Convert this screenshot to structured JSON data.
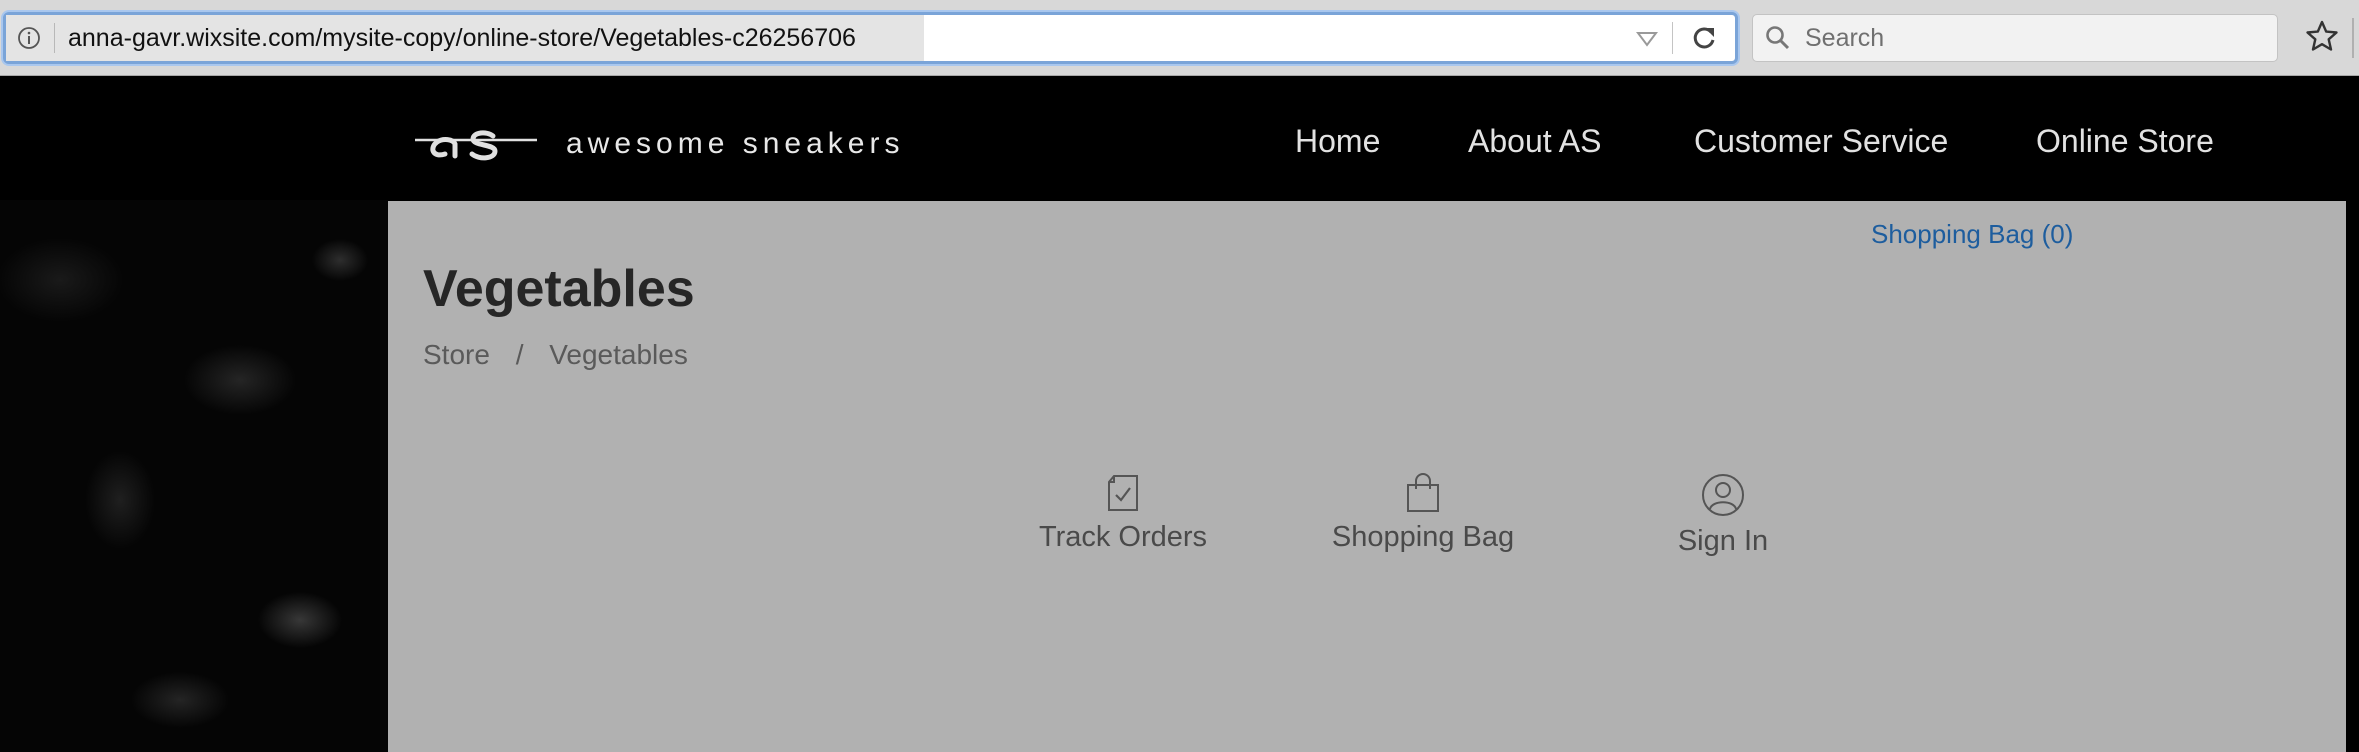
{
  "browser": {
    "url": "anna-gavr.wixsite.com/mysite-copy/online-store/Vegetables-c26256706",
    "search_placeholder": "Search",
    "icons": [
      "info-icon",
      "dropmarker-icon",
      "reload-icon",
      "search-icon",
      "bookmark-star-icon"
    ]
  },
  "site": {
    "brand": "awesome sneakers",
    "logo_icon": "as-logo",
    "nav": [
      {
        "label": "Home"
      },
      {
        "label": "About AS"
      },
      {
        "label": "Customer Service"
      },
      {
        "label": "Online Store"
      }
    ],
    "shopping_bag_link": "Shopping Bag (0)",
    "page_title": "Vegetables",
    "breadcrumb": {
      "root": "Store",
      "separator": "/",
      "current": "Vegetables"
    },
    "actions": [
      {
        "label": "Track Orders",
        "icon": "track-orders-icon"
      },
      {
        "label": "Shopping Bag",
        "icon": "shopping-bag-icon"
      },
      {
        "label": "Sign In",
        "icon": "user-icon"
      }
    ],
    "colors": {
      "header_bg": "#000000",
      "content_bg": "#b1b1b1",
      "link": "#1d5d9e"
    }
  }
}
